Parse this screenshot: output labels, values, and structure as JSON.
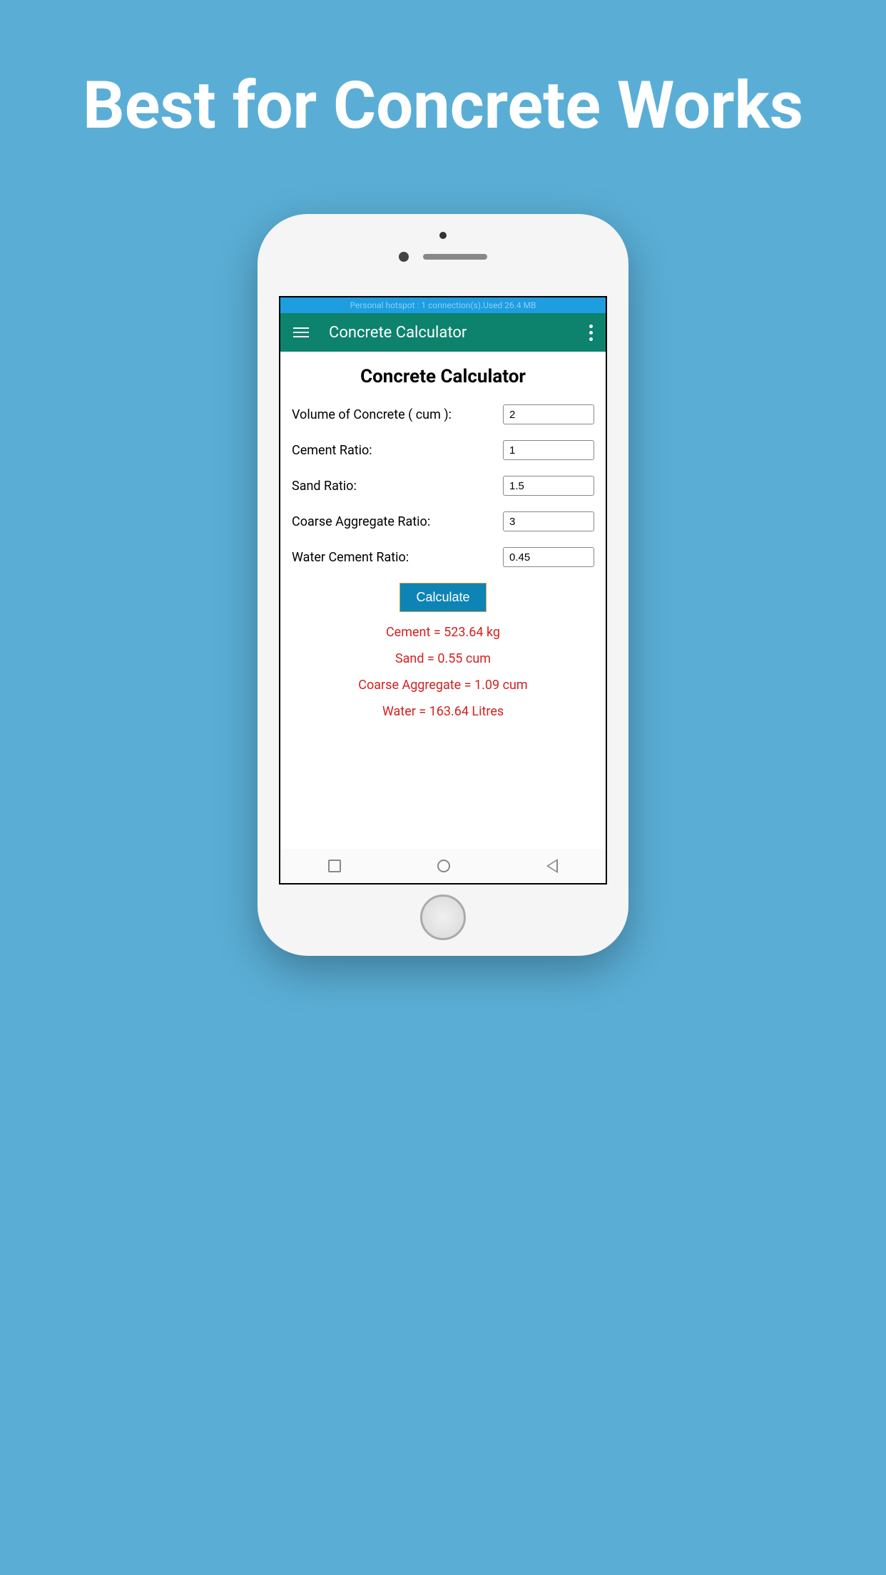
{
  "hero": {
    "title": "Best for Concrete Works"
  },
  "statusBar": {
    "text": "Personal hotspot : 1 connection(s).Used  26.4 MB"
  },
  "appBar": {
    "title": "Concrete Calculator"
  },
  "page": {
    "heading": "Concrete Calculator"
  },
  "form": {
    "volume": {
      "label": "Volume of Concrete ( cum ):",
      "value": "2"
    },
    "cement": {
      "label": "Cement Ratio:",
      "value": "1"
    },
    "sand": {
      "label": "Sand Ratio:",
      "value": "1.5"
    },
    "coarse": {
      "label": "Coarse Aggregate Ratio:",
      "value": "3"
    },
    "water": {
      "label": "Water Cement Ratio:",
      "value": "0.45"
    },
    "button": "Calculate"
  },
  "results": {
    "cement": "Cement = 523.64 kg",
    "sand": "Sand = 0.55 cum",
    "coarse": "Coarse Aggregate = 1.09 cum",
    "water": "Water = 163.64 Litres"
  }
}
